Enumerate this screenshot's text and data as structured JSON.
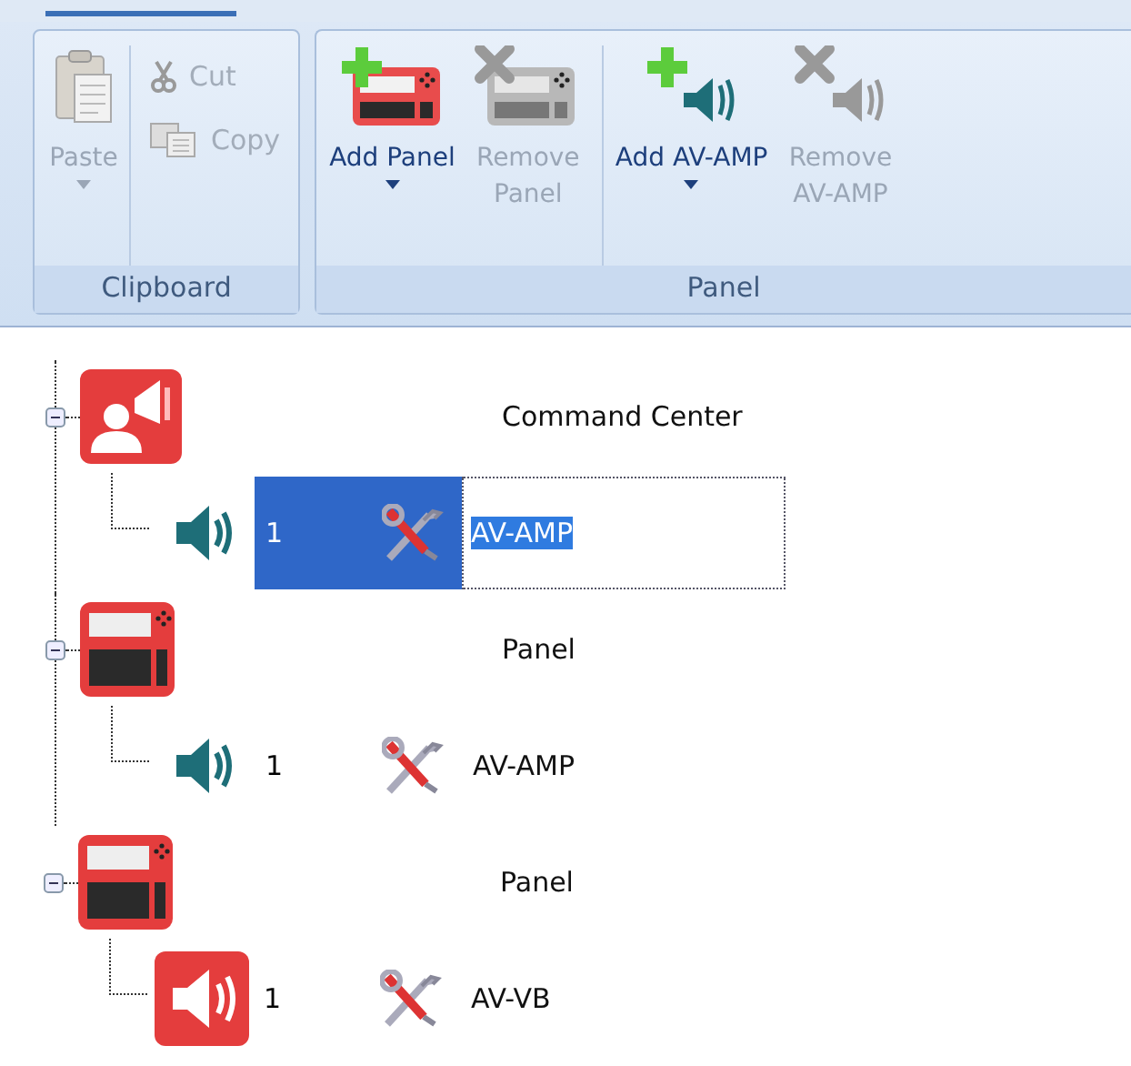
{
  "ribbon": {
    "groups": [
      {
        "label": "Clipboard",
        "buttons": [
          {
            "kind": "paste",
            "label": "Paste",
            "disabled": true,
            "dropdown": true
          },
          {
            "kind": "cut",
            "label": "Cut",
            "disabled": true
          },
          {
            "kind": "copy",
            "label": "Copy",
            "disabled": true
          }
        ]
      },
      {
        "label": "Panel",
        "buttons": [
          {
            "kind": "add-panel",
            "label": "Add Panel",
            "disabled": false,
            "dropdown": true
          },
          {
            "kind": "remove-panel",
            "label": "Remove Panel",
            "disabled": true,
            "dropdown": false
          },
          {
            "kind": "add-amp",
            "label": "Add AV-AMP",
            "disabled": false,
            "dropdown": true
          },
          {
            "kind": "remove-amp",
            "label": "Remove AV-AMP",
            "disabled": true,
            "dropdown": false
          }
        ]
      }
    ]
  },
  "tree": [
    {
      "kind": "command-center",
      "label": "Command Center",
      "expanded": true,
      "children": [
        {
          "kind": "amp",
          "number": "1",
          "label": "AV-AMP",
          "selected": true
        }
      ]
    },
    {
      "kind": "panel",
      "label": "Panel",
      "expanded": true,
      "children": [
        {
          "kind": "amp",
          "number": "1",
          "label": "AV-AMP",
          "selected": false
        }
      ]
    },
    {
      "kind": "panel",
      "label": "Panel",
      "expanded": true,
      "children": [
        {
          "kind": "vb",
          "number": "1",
          "label": "AV-VB",
          "selected": false
        }
      ]
    }
  ]
}
